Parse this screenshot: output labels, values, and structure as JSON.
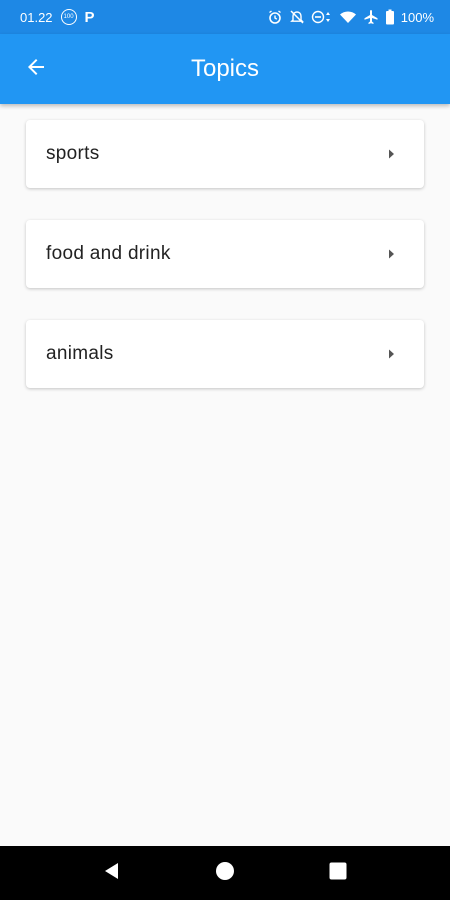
{
  "status_bar": {
    "time": "01.22",
    "badge_text": "100",
    "parking_label": "P",
    "battery_text": "100%",
    "icons": [
      "badge-icon",
      "parking-icon",
      "alarm-icon",
      "notifications-off-icon",
      "dnd-icon",
      "wifi-icon",
      "airplane-icon",
      "battery-icon"
    ]
  },
  "app_bar": {
    "title": "Topics",
    "back_icon": "arrow-left-icon",
    "color": "#2196f3"
  },
  "topics": [
    {
      "label": "sports",
      "icon": "chevron-right-icon"
    },
    {
      "label": "food and drink",
      "icon": "chevron-right-icon"
    },
    {
      "label": "animals",
      "icon": "chevron-right-icon"
    }
  ],
  "nav_bar": {
    "buttons": [
      "back-triangle-icon",
      "home-circle-icon",
      "recents-square-icon"
    ]
  },
  "colors": {
    "status_bar": "#1e88e5",
    "app_bar": "#2196f3",
    "background": "#fafafa"
  }
}
